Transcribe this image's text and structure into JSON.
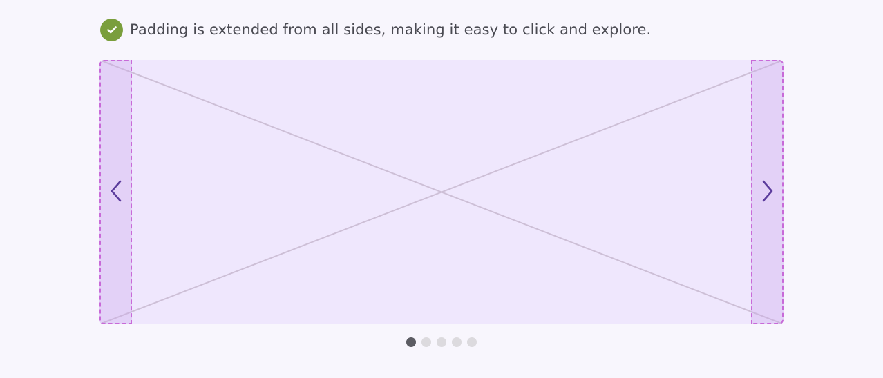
{
  "note": {
    "icon": "check-circle-icon",
    "text": "Padding is extended from all sides, making it easy to click and explore.",
    "icon_color": "#7a9e3c"
  },
  "carousel": {
    "slide_placeholder_icon": "image-placeholder-cross",
    "prev_icon": "chevron-left-icon",
    "next_icon": "chevron-right-icon",
    "slide_bg_color": "#efe7fd",
    "hit_area_border_color": "#c86ad8",
    "chevron_color": "#5b3b9c",
    "pagination": {
      "total": 5,
      "active_index": 1
    }
  }
}
